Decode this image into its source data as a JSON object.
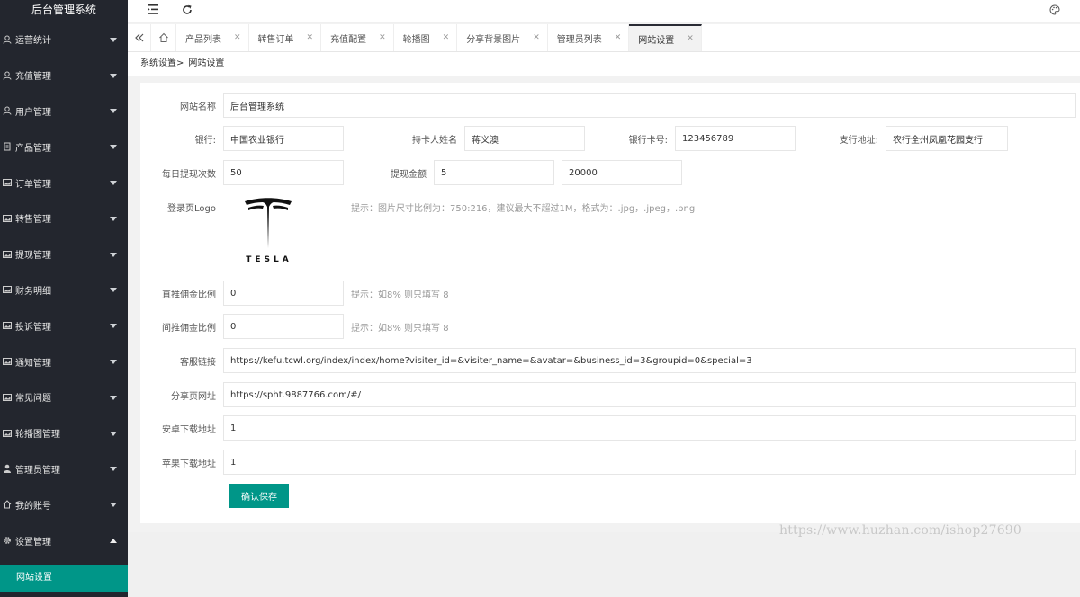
{
  "app": {
    "title": "后台管理系统"
  },
  "colors": {
    "sidebar_bg": "#23262e",
    "accent": "#009688"
  },
  "sidebar": {
    "items": [
      {
        "label": "运营统计",
        "icon": "user-icon"
      },
      {
        "label": "充值管理",
        "icon": "user-icon"
      },
      {
        "label": "用户管理",
        "icon": "user-icon"
      },
      {
        "label": "产品管理",
        "icon": "file-icon"
      },
      {
        "label": "订单管理",
        "icon": "image-icon"
      },
      {
        "label": "转售管理",
        "icon": "image-icon"
      },
      {
        "label": "提现管理",
        "icon": "image-icon"
      },
      {
        "label": "财务明细",
        "icon": "image-icon"
      },
      {
        "label": "投诉管理",
        "icon": "image-icon"
      },
      {
        "label": "通知管理",
        "icon": "image-icon"
      },
      {
        "label": "常见问题",
        "icon": "image-icon"
      },
      {
        "label": "轮播图管理",
        "icon": "image-icon"
      },
      {
        "label": "管理员管理",
        "icon": "person-icon"
      },
      {
        "label": "我的账号",
        "icon": "home-icon"
      },
      {
        "label": "设置管理",
        "icon": "gear-icon"
      }
    ],
    "active_sub": "网站设置"
  },
  "tabs": [
    {
      "label": "产品列表"
    },
    {
      "label": "转售订单"
    },
    {
      "label": "充值配置"
    },
    {
      "label": "轮播图"
    },
    {
      "label": "分享背景图片"
    },
    {
      "label": "管理员列表"
    },
    {
      "label": "网站设置"
    }
  ],
  "breadcrumb": {
    "parent": "系统设置>",
    "current": "网站设置"
  },
  "form": {
    "site_name_label": "网站名称",
    "site_name": "后台管理系统",
    "bank_label": "银行:",
    "bank": "中国农业银行",
    "holder_label": "持卡人姓名",
    "holder": "蒋义澳",
    "card_label": "银行卡号:",
    "card": "123456789",
    "branch_label": "支行地址:",
    "branch": "农行全州凤凰花园支行",
    "daily_label": "每日提现次数",
    "daily": "50",
    "withdraw_label": "提现金额",
    "withdraw_min": "5",
    "withdraw_max": "20000",
    "logo_label": "登录页Logo",
    "logo_hint": "提示：图片尺寸比例为：750:216，建议最大不超过1M，格式为：.jpg，.jpeg，.png",
    "logo_text": "TESLA",
    "direct_label": "直推佣金比例",
    "direct": "0",
    "direct_hint": "提示：如8% 则只填写 8",
    "indirect_label": "间推佣金比例",
    "indirect": "0",
    "indirect_hint": "提示：如8% 则只填写 8",
    "kefu_label": "客服链接",
    "kefu": "https://kefu.tcwl.org/index/index/home?visiter_id=&visiter_name=&avatar=&business_id=3&groupid=0&special=3",
    "share_label": "分享页网址",
    "share": "https://spht.9887766.com/#/",
    "android_label": "安卓下载地址",
    "android": "1",
    "ios_label": "苹果下载地址",
    "ios": "1",
    "save_label": "确认保存"
  },
  "watermark": "https://www.huzhan.com/ishop27690"
}
